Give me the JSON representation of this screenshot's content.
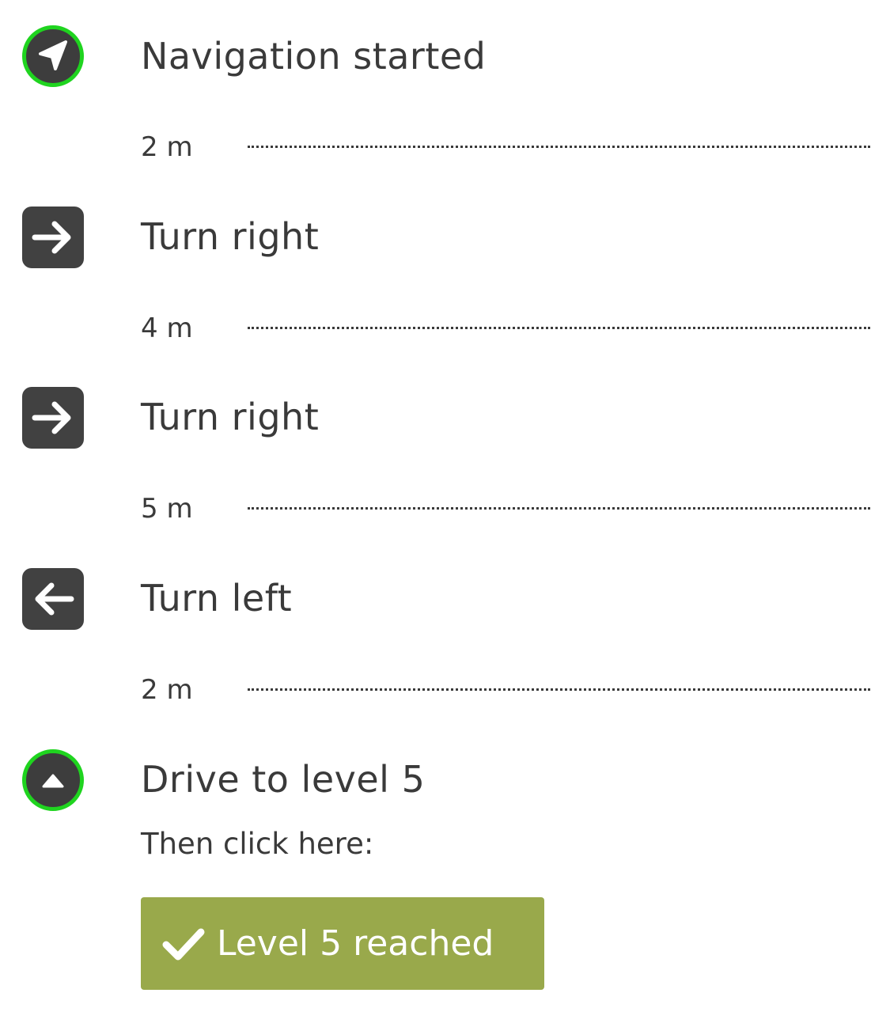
{
  "steps": [
    {
      "icon": "navigation-arrow-icon",
      "title": "Navigation started",
      "distance_after": "2 m"
    },
    {
      "icon": "arrow-right-icon",
      "title": "Turn right",
      "distance_after": "4 m"
    },
    {
      "icon": "arrow-right-icon",
      "title": "Turn right",
      "distance_after": "5 m"
    },
    {
      "icon": "arrow-left-icon",
      "title": "Turn left",
      "distance_after": "2 m"
    },
    {
      "icon": "level-up-icon",
      "title": "Drive to level 5"
    }
  ],
  "final_step": {
    "instruction": "Then click here:",
    "button_label": "Level 5 reached",
    "button_icon": "checkmark-icon"
  },
  "colors": {
    "active_ring": "#1fd41f",
    "icon_background": "#414141",
    "button_background": "#99a94b",
    "text": "#3a3a3a"
  }
}
